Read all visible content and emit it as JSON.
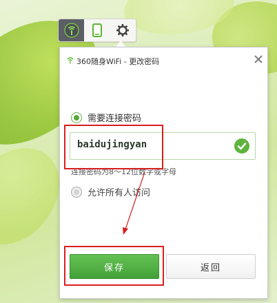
{
  "window": {
    "title": "360随身WiFi - 更改密码"
  },
  "toolbar": {
    "items": [
      {
        "icon": "wifi-signal-icon",
        "active": true
      },
      {
        "icon": "phone-icon",
        "active": false
      },
      {
        "icon": "gear-icon",
        "active": false
      }
    ]
  },
  "options": {
    "require_password_label": "需要连接密码",
    "require_password_checked": true,
    "allow_all_label": "允许所有人访问",
    "allow_all_checked": false
  },
  "password": {
    "value": "baidujingyan",
    "valid": true,
    "hint": "连接密码为8～12位数字或字母"
  },
  "buttons": {
    "save_label": "保存",
    "back_label": "返回"
  },
  "colors": {
    "accent_green": "#4aa83b",
    "annotation_red": "#d81e1e"
  }
}
